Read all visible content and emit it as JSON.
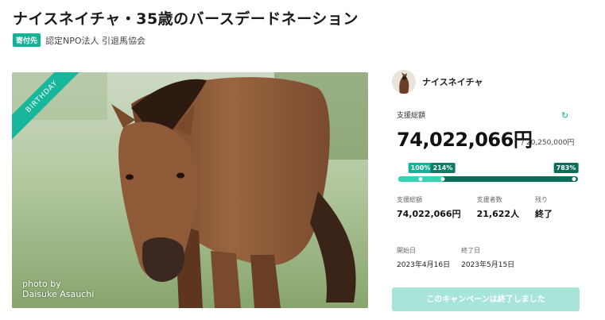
{
  "project": {
    "title": "ナイスネイチャ・35歳のバースデードネーション",
    "badge": "寄付先",
    "organization": "認定NPO法人 引退馬協会"
  },
  "photo": {
    "ribbon": "BIRTHDAY",
    "credit_line1": "photo by",
    "credit_line2": "Daisuke Asauchi"
  },
  "sidebar": {
    "owner_name": "ナイスネイチャ",
    "total_label": "支援総額",
    "total_amount": "74,022,066円",
    "target_amount": "/ 20,250,000円",
    "progress": {
      "markers": [
        "100%",
        "214%",
        "783%"
      ],
      "percent_achieved": 783
    },
    "stats": [
      {
        "label": "支援総額",
        "value": "74,022,066円"
      },
      {
        "label": "支援者数",
        "value": "21,622人"
      },
      {
        "label": "残り",
        "value": "終了"
      }
    ],
    "dates": [
      {
        "label": "開始日",
        "value": "2023年4月16日"
      },
      {
        "label": "終了日",
        "value": "2023年5月15日"
      }
    ],
    "cta_label": "このキャンペーンは終了しました"
  },
  "colors": {
    "accent": "#13b39a",
    "progress_dark": "#0b6e59",
    "progress_light": "#38d3b4",
    "cta_disabled": "#a7e5d9"
  }
}
